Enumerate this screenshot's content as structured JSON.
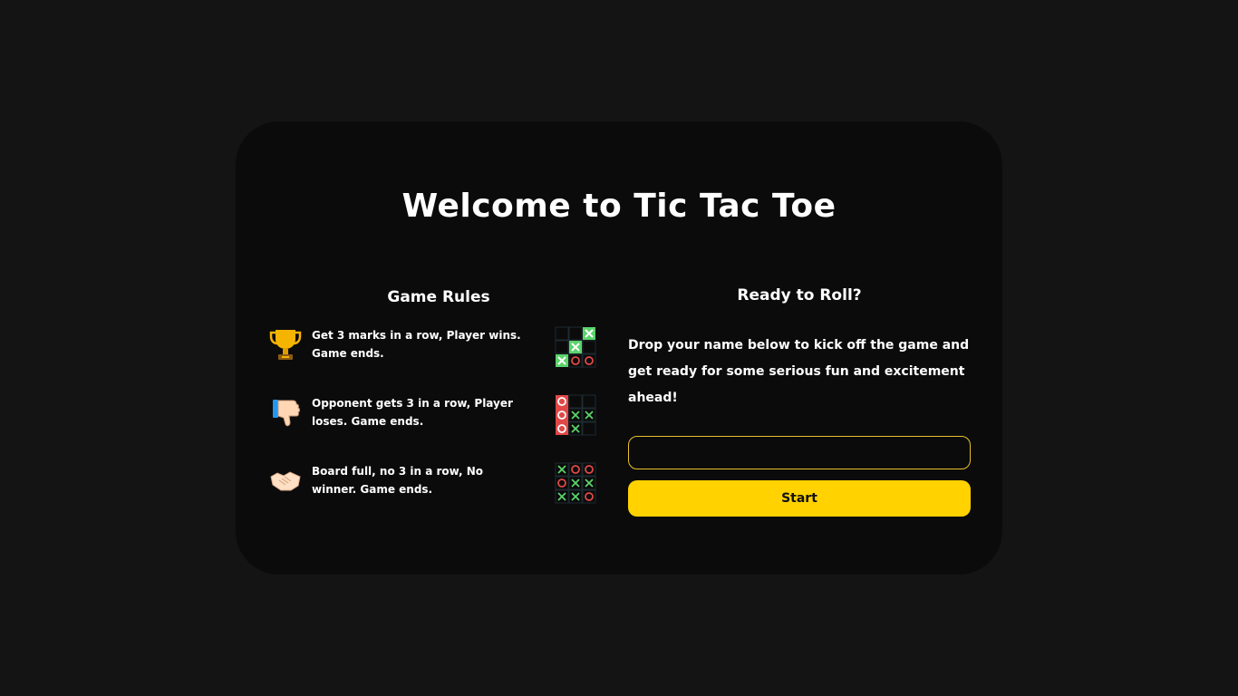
{
  "title": "Welcome to Tic Tac Toe",
  "rules": {
    "heading": "Game Rules",
    "items": [
      {
        "icon": "trophy-icon",
        "text": "Get 3 marks in a row, Player wins. Game ends."
      },
      {
        "icon": "thumbs-down-icon",
        "text": "Opponent gets 3 in a row, Player loses. Game ends."
      },
      {
        "icon": "handshake-icon",
        "text": "Board full, no 3 in a row, No winner. Game ends."
      }
    ]
  },
  "ready": {
    "heading": "Ready to Roll?",
    "description": "Drop your name below to kick off the game and get ready for some serious fun and excitement ahead!",
    "input_value": "",
    "start_label": "Start"
  },
  "colors": {
    "background": "#141414",
    "card": "#0b0b0b",
    "accent": "#ffd200",
    "x_mark": "#5ad46a",
    "o_mark": "#e04848"
  }
}
